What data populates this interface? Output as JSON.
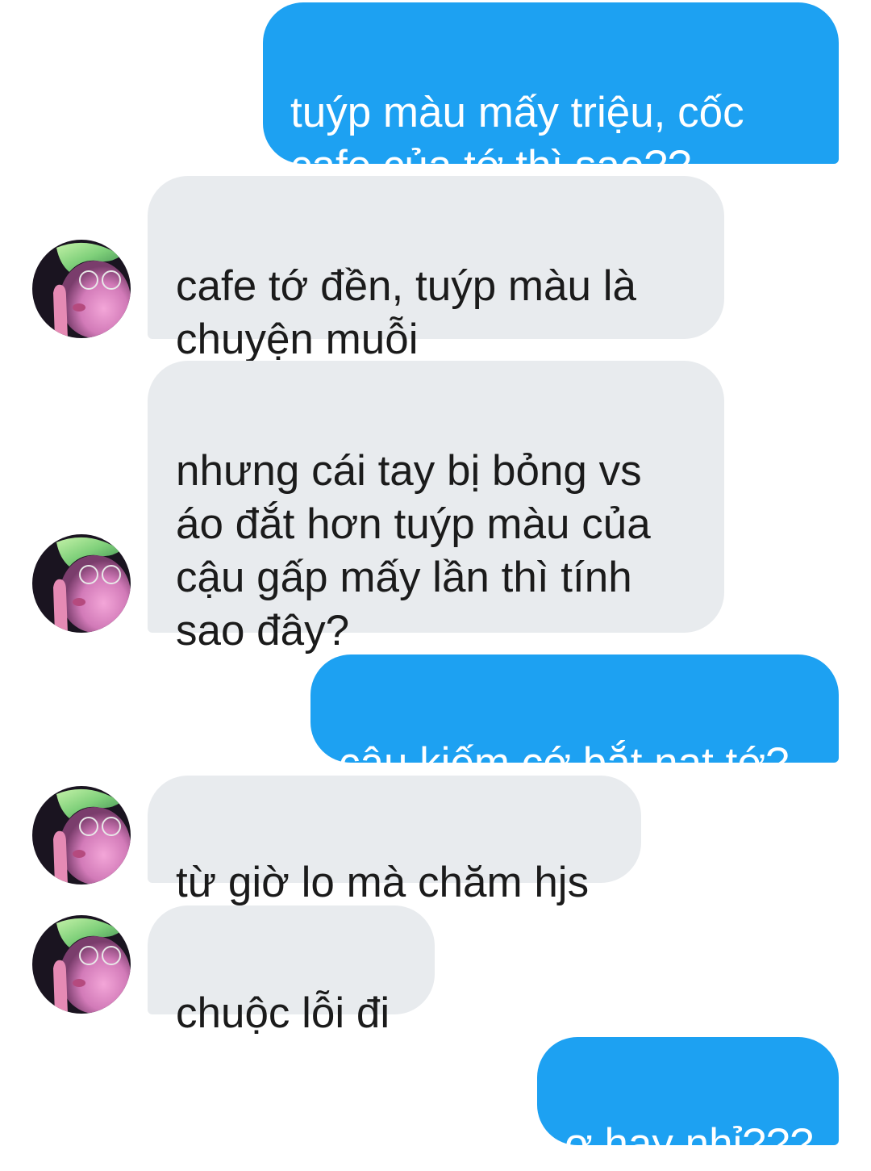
{
  "messages": [
    {
      "sender": "me",
      "text": "tuýp màu mấy triệu, cốc\ncafe của tớ thì sao??"
    },
    {
      "sender": "them",
      "text": "cafe tớ đền, tuýp màu là\nchuyện muỗi"
    },
    {
      "sender": "them",
      "text": "nhưng cái tay bị bỏng vs\náo đắt hơn tuýp màu của\ncậu gấp mấy lần thì tính\nsao đây?"
    },
    {
      "sender": "me",
      "text": "cậu kiếm cớ bắt nạt tớ?"
    },
    {
      "sender": "them",
      "text": "từ giờ lo mà chăm hjs"
    },
    {
      "sender": "them",
      "text": "chuộc lỗi đi"
    },
    {
      "sender": "me",
      "text": "ơ hay nhỉ???"
    }
  ],
  "colors": {
    "sent_bubble": "#1da1f2",
    "received_bubble": "#e8ebee",
    "background": "#ffffff"
  },
  "icons": {
    "avatar": "contact-avatar-photo"
  }
}
